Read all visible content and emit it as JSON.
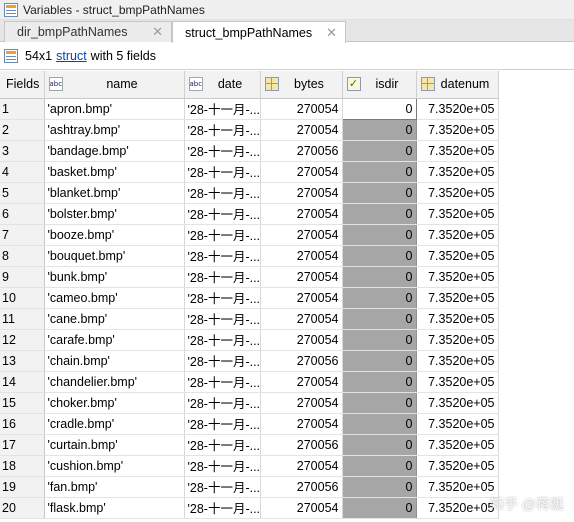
{
  "window": {
    "title": "Variables - struct_bmpPathNames"
  },
  "tabs": [
    {
      "label": "dir_bmpPathNames",
      "active": false
    },
    {
      "label": "struct_bmpPathNames",
      "active": true
    }
  ],
  "info": {
    "size": "54x1",
    "type_link": "struct",
    "suffix": "with 5 fields"
  },
  "table": {
    "headers": [
      "Fields",
      "name",
      "date",
      "bytes",
      "isdir",
      "datenum"
    ],
    "rows": [
      [
        "1",
        "'apron.bmp'",
        "'28-十一月-...",
        "270054",
        "0",
        "7.3520e+05"
      ],
      [
        "2",
        "'ashtray.bmp'",
        "'28-十一月-...",
        "270054",
        "0",
        "7.3520e+05"
      ],
      [
        "3",
        "'bandage.bmp'",
        "'28-十一月-...",
        "270056",
        "0",
        "7.3520e+05"
      ],
      [
        "4",
        "'basket.bmp'",
        "'28-十一月-...",
        "270054",
        "0",
        "7.3520e+05"
      ],
      [
        "5",
        "'blanket.bmp'",
        "'28-十一月-...",
        "270054",
        "0",
        "7.3520e+05"
      ],
      [
        "6",
        "'bolster.bmp'",
        "'28-十一月-...",
        "270054",
        "0",
        "7.3520e+05"
      ],
      [
        "7",
        "'booze.bmp'",
        "'28-十一月-...",
        "270054",
        "0",
        "7.3520e+05"
      ],
      [
        "8",
        "'bouquet.bmp'",
        "'28-十一月-...",
        "270054",
        "0",
        "7.3520e+05"
      ],
      [
        "9",
        "'bunk.bmp'",
        "'28-十一月-...",
        "270054",
        "0",
        "7.3520e+05"
      ],
      [
        "10",
        "'cameo.bmp'",
        "'28-十一月-...",
        "270054",
        "0",
        "7.3520e+05"
      ],
      [
        "11",
        "'cane.bmp'",
        "'28-十一月-...",
        "270054",
        "0",
        "7.3520e+05"
      ],
      [
        "12",
        "'carafe.bmp'",
        "'28-十一月-...",
        "270054",
        "0",
        "7.3520e+05"
      ],
      [
        "13",
        "'chain.bmp'",
        "'28-十一月-...",
        "270056",
        "0",
        "7.3520e+05"
      ],
      [
        "14",
        "'chandelier.bmp'",
        "'28-十一月-...",
        "270054",
        "0",
        "7.3520e+05"
      ],
      [
        "15",
        "'choker.bmp'",
        "'28-十一月-...",
        "270054",
        "0",
        "7.3520e+05"
      ],
      [
        "16",
        "'cradle.bmp'",
        "'28-十一月-...",
        "270054",
        "0",
        "7.3520e+05"
      ],
      [
        "17",
        "'curtain.bmp'",
        "'28-十一月-...",
        "270056",
        "0",
        "7.3520e+05"
      ],
      [
        "18",
        "'cushion.bmp'",
        "'28-十一月-...",
        "270054",
        "0",
        "7.3520e+05"
      ],
      [
        "19",
        "'fan.bmp'",
        "'28-十一月-...",
        "270056",
        "0",
        "7.3520e+05"
      ],
      [
        "20",
        "'flask.bmp'",
        "'28-十一月-...",
        "270054",
        "0",
        "7.3520e+05"
      ]
    ]
  },
  "watermark": "知乎 @蒋蜓",
  "colors": {
    "isdir_fill": "#a6a6a6",
    "link": "#0645ad",
    "header_bg": "#f2f2f2"
  }
}
